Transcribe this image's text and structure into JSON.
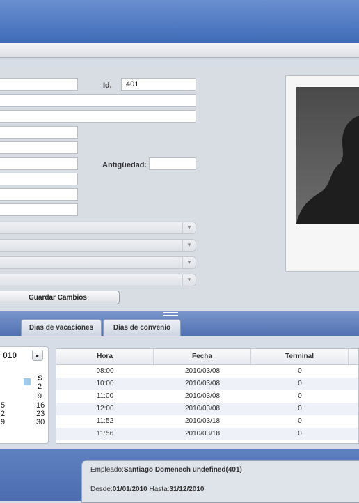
{
  "form": {
    "id_label": "Id.",
    "id_value": "401",
    "antiguedad_label": "Antigüedad:",
    "save_label": "Guardar Cambios"
  },
  "tabs": [
    {
      "label": "Dias de vacaciones"
    },
    {
      "label": "Dias de convenio"
    }
  ],
  "calendar": {
    "year_partial": "010",
    "next_icon": "▸",
    "day_header": "S",
    "col_s": [
      "2",
      "9",
      "16",
      "23",
      "30"
    ],
    "col_prev": [
      "5",
      "2",
      "9"
    ]
  },
  "table": {
    "headers": [
      "Hora",
      "Fecha",
      "Terminal"
    ],
    "rows": [
      [
        "08:00",
        "2010/03/08",
        "0"
      ],
      [
        "10:00",
        "2010/03/08",
        "0"
      ],
      [
        "11:00",
        "2010/03/08",
        "0"
      ],
      [
        "12:00",
        "2010/03/08",
        "0"
      ],
      [
        "11:52",
        "2010/03/18",
        "0"
      ],
      [
        "11:56",
        "2010/03/18",
        "0"
      ]
    ]
  },
  "footer": {
    "empleado_label": "Empleado:",
    "empleado_value": "Santiago Domenech undefined(401)",
    "desde_label": "Desde:",
    "desde_value": "01/01/2010",
    "hasta_label": " Hasta:",
    "hasta_value": "31/12/2010"
  },
  "colors": {
    "header_blue": "#4f72b8",
    "calendar_selection": "#9ecbec"
  }
}
